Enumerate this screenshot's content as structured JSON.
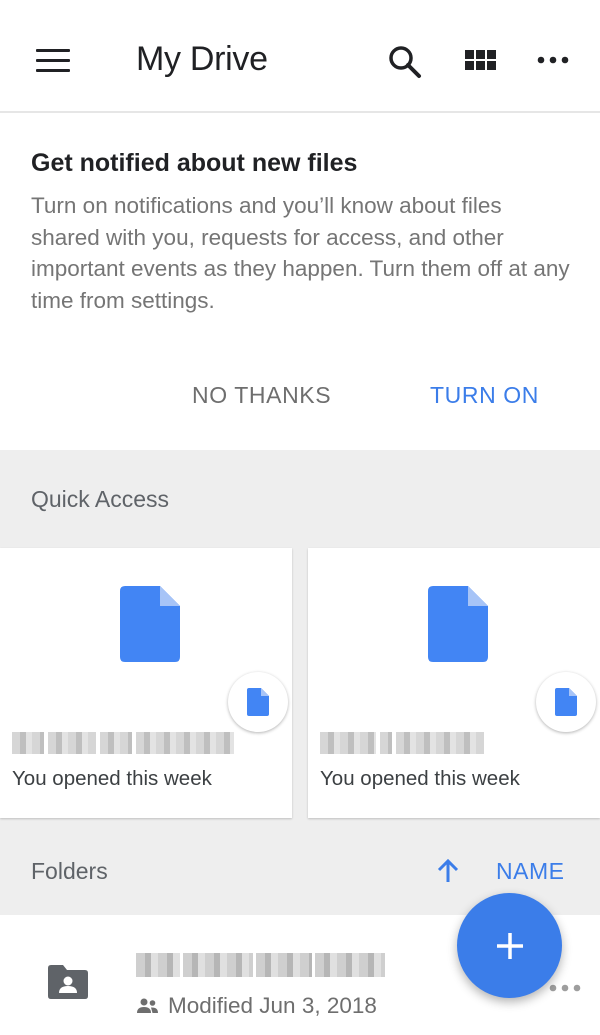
{
  "appbar": {
    "title": "My Drive",
    "icons": [
      "menu-icon",
      "search-icon",
      "grid-view-icon",
      "more-icon"
    ]
  },
  "banner": {
    "title": "Get notified about new files",
    "body": "Turn on notifications and you’ll know about files shared with you, requests for access, and other important events as they happen. Turn them off at any time from settings.",
    "no_thanks_label": "NO THANKS",
    "turn_on_label": "TURN ON"
  },
  "quick_access": {
    "label": "Quick Access",
    "cards": [
      {
        "subtitle": "You opened this week",
        "icon": "doc-icon"
      },
      {
        "subtitle": "You opened this week",
        "icon": "doc-icon"
      }
    ]
  },
  "folders": {
    "label": "Folders",
    "sort_label": "NAME",
    "items": [
      {
        "meta": "Modified Jun 3, 2018",
        "icon": "shared-folder-icon"
      }
    ]
  },
  "colors": {
    "accent": "#3b7de9",
    "section_bg": "#eeeeee",
    "muted_text": "#757575"
  }
}
